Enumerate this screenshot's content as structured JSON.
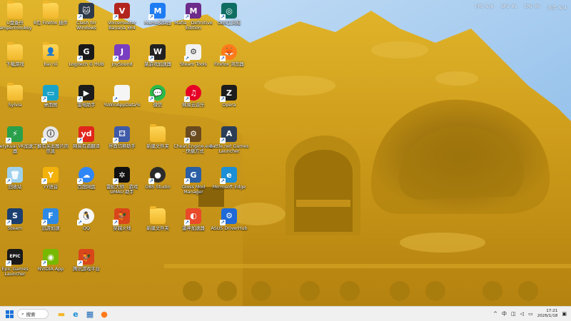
{
  "hud": {
    "fps_label": "FPS",
    "fps_value": "N/A",
    "gpu_label": "GPU",
    "gpu_value": "0%",
    "cpu_label": "CPU",
    "cpu_value": "0%",
    "mem_label": "内存",
    "mem_value": "N/A"
  },
  "desktop_icons": [
    {
      "label": "U盘备份\nlampermonkey",
      "icon": "folder-icon",
      "glyph": "",
      "color": "#f1b72a"
    },
    {
      "label": "8包 Firefox 插件",
      "icon": "folder-icon",
      "glyph": "",
      "color": "#f1b72a"
    },
    {
      "label": "Clash for\nWindows",
      "icon": "clash-cat-icon",
      "glyph": "🐱",
      "color": "#2f3a4a"
    },
    {
      "label": "Voicemeeter\nBanana x64",
      "icon": "voicemeeter-icon",
      "glyph": "V",
      "color": "#b3261e"
    },
    {
      "label": "MuMu模拟器",
      "icon": "mumu-icon",
      "glyph": "M",
      "color": "#1e7cf2"
    },
    {
      "label": "Mafia - Definitive\nEdition",
      "icon": "mafia-game-icon",
      "glyph": "M",
      "color": "#6d2b8a"
    },
    {
      "label": "OBS工具箱",
      "icon": "wheel-app-icon",
      "glyph": "◎",
      "color": "#0f6e62"
    },
    {
      "label": "下载游戏",
      "icon": "folder-icon",
      "glyph": "",
      "color": "#f1b72a"
    },
    {
      "label": "bai nii",
      "icon": "user-folder-icon",
      "glyph": "👤",
      "color": "#f1b72a"
    },
    {
      "label": "Logitech G HUB",
      "icon": "logitech-g-icon",
      "glyph": "G",
      "color": "#1a1a1a"
    },
    {
      "label": "JoySound",
      "icon": "joysound-icon",
      "glyph": "J",
      "color": "#7a3ec2"
    },
    {
      "label": "某游戏加速器",
      "icon": "game-accelerator-icon",
      "glyph": "W",
      "color": "#222222"
    },
    {
      "label": "Steam Tools",
      "icon": "gear-app-icon",
      "glyph": "⚙",
      "color": "#f2f2f2"
    },
    {
      "label": "Firefox 浏览器",
      "icon": "firefox-icon",
      "glyph": "🦊",
      "color": "#ff7a1a"
    },
    {
      "label": "Sylvia",
      "icon": "folder-icon",
      "glyph": "",
      "color": "#f1b72a"
    },
    {
      "label": "桌面图",
      "icon": "monitor-icon",
      "glyph": "▭",
      "color": "#1aa3c9"
    },
    {
      "label": "雷电助手",
      "icon": "leidian-icon",
      "glyph": "▶",
      "color": "#1c1c1c"
    },
    {
      "label": "%WinAppData%",
      "icon": "document-icon",
      "glyph": "",
      "color": "#f5f5f5"
    },
    {
      "label": "微信",
      "icon": "wechat-icon",
      "glyph": "💬",
      "color": "#29b94a"
    },
    {
      "label": "网易云音乐",
      "icon": "netease-music-icon",
      "glyph": "♫",
      "color": "#e60026"
    },
    {
      "label": "Opera",
      "icon": "z-app-icon",
      "glyph": "Z",
      "color": "#1d1d1d"
    },
    {
      "label": "VeryKuai VK加速\n器",
      "icon": "verykuai-icon",
      "glyph": "⚡",
      "color": "#2aa04b"
    },
    {
      "label": "了解有关此图片的\n信息",
      "icon": "info-icon",
      "glyph": "ⓘ",
      "color": "#e8e8e8"
    },
    {
      "label": "网易有道翻译",
      "icon": "youdao-icon",
      "glyph": "yd",
      "color": "#e1261c"
    },
    {
      "label": "界面切换助手",
      "icon": "switch-helper-icon",
      "glyph": "⚃",
      "color": "#3f5aa8"
    },
    {
      "label": "新建文件夹",
      "icon": "folder-icon",
      "glyph": "",
      "color": "#f1b72a"
    },
    {
      "label": "Cheat Engine.exe\n- 快捷方式",
      "icon": "cheat-engine-icon",
      "glyph": "⚙",
      "color": "#6a4a1f"
    },
    {
      "label": "Battle.net Games\nLauncher",
      "icon": "launcher-a-icon",
      "glyph": "A",
      "color": "#2c3e57"
    },
    {
      "label": "回收站",
      "icon": "recycle-bin-icon",
      "glyph": "🗑",
      "color": "#9fd1ee"
    },
    {
      "label": "YY语音",
      "icon": "yy-icon",
      "glyph": "Y",
      "color": "#f2b20b"
    },
    {
      "label": "百度网盘",
      "icon": "baidu-netdisk-icon",
      "glyph": "☁",
      "color": "#2f86f6"
    },
    {
      "label": "雷蛇大师 - 游戏\nUMAU 助手",
      "icon": "spider-app-icon",
      "glyph": "✲",
      "color": "#111111"
    },
    {
      "label": "OBS Studio",
      "icon": "obs-icon",
      "glyph": "●",
      "color": "#2b2b2b"
    },
    {
      "label": "Gloss Mod\nManager",
      "icon": "gloss-mod-icon",
      "glyph": "G",
      "color": "#2a5fa6"
    },
    {
      "label": "Microsoft Edge",
      "icon": "edge-icon",
      "glyph": "e",
      "color": "#1c8fd6"
    },
    {
      "label": "Steam",
      "icon": "steam-icon",
      "glyph": "S",
      "color": "#1b3f70"
    },
    {
      "label": "迅游加速",
      "icon": "xunyou-icon",
      "glyph": "F",
      "color": "#2c8ae6"
    },
    {
      "label": "QQ",
      "icon": "qq-icon",
      "glyph": "🐧",
      "color": "#f7f7f7"
    },
    {
      "label": "穿越火线",
      "icon": "rooster-app-icon",
      "glyph": "🐓",
      "color": "#d9461a"
    },
    {
      "label": "新建文件夹",
      "icon": "folder-icon",
      "glyph": "",
      "color": "#f1b72a"
    },
    {
      "label": "雷神加速器",
      "icon": "lightning-app-icon",
      "glyph": "◐",
      "color": "#e84a2a"
    },
    {
      "label": "ASUS DriverHub",
      "icon": "asus-gear-icon",
      "glyph": "⚙",
      "color": "#1f6ad8"
    },
    {
      "label": "Epic Games\nLauncher",
      "icon": "epic-games-icon",
      "glyph": "EPIC",
      "color": "#1a1a1a"
    },
    {
      "label": "NVIDIA App",
      "icon": "nvidia-icon",
      "glyph": "◉",
      "color": "#76b900"
    },
    {
      "label": "腾讯游戏平台",
      "icon": "rooster-app-icon",
      "glyph": "🐓",
      "color": "#d9461a"
    }
  ],
  "taskbar": {
    "search_label": "搜索",
    "pinned": [
      {
        "icon": "file-explorer-icon",
        "glyph": "▬",
        "color": "#f1b72a"
      },
      {
        "icon": "edge-icon",
        "glyph": "e",
        "color": "#1c8fd6"
      },
      {
        "icon": "store-icon",
        "glyph": "▦",
        "color": "#1c68b8"
      },
      {
        "icon": "firefox-icon",
        "glyph": "●",
        "color": "#ff7a1a"
      }
    ],
    "tray": {
      "chevron": "^",
      "ime": "中",
      "time": "17:21",
      "date": "2026/1/18"
    }
  }
}
